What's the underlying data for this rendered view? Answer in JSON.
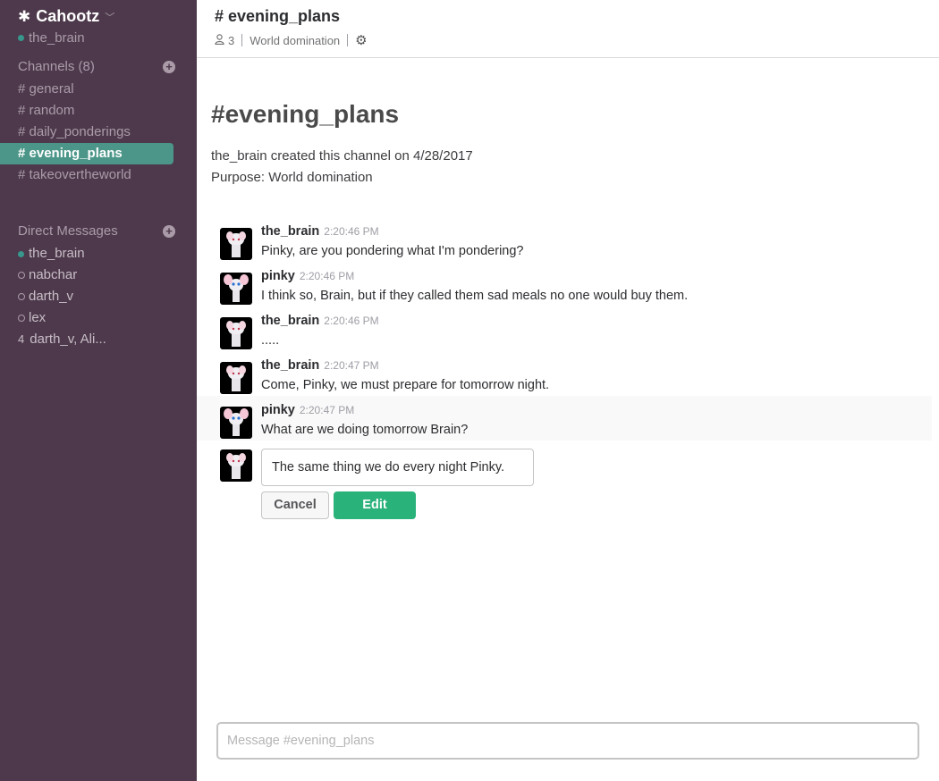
{
  "team": {
    "name": "Cahootz",
    "user": "the_brain"
  },
  "channels": {
    "heading": "Channels (8)",
    "items": [
      {
        "label": "# general"
      },
      {
        "label": "# random"
      },
      {
        "label": "# daily_ponderings"
      },
      {
        "label": "# evening_plans",
        "active": true
      },
      {
        "label": "# takeovertheworld"
      }
    ]
  },
  "dms": {
    "heading": "Direct Messages",
    "items": [
      {
        "label": "the_brain",
        "status": "online"
      },
      {
        "label": "nabchar",
        "status": "offline"
      },
      {
        "label": "darth_v",
        "status": "offline"
      },
      {
        "label": "lex",
        "status": "offline"
      },
      {
        "count": "4",
        "label": "darth_v, Ali..."
      }
    ]
  },
  "header": {
    "title": "# evening_plans",
    "members": "3",
    "purpose": "World domination"
  },
  "intro": {
    "title": "#evening_plans",
    "created": "the_brain created this channel on 4/28/2017",
    "purpose": "Purpose: World domination"
  },
  "messages": [
    {
      "user": "the_brain",
      "time": "2:20:46 PM",
      "text": "Pinky, are you pondering what I'm pondering?"
    },
    {
      "user": "pinky",
      "time": "2:20:46 PM",
      "text": "I think so, Brain, but if they called them sad meals no one would buy them."
    },
    {
      "user": "the_brain",
      "time": "2:20:46 PM",
      "text": "....."
    },
    {
      "user": "the_brain",
      "time": "2:20:47 PM",
      "text": "Come, Pinky, we must prepare for tomorrow night."
    },
    {
      "user": "pinky",
      "time": "2:20:47 PM",
      "text": "What are we doing tomorrow Brain?"
    }
  ],
  "edit": {
    "value": "The same thing we do every night Pinky.",
    "cancel": "Cancel",
    "submit": "Edit"
  },
  "composer": {
    "placeholder": "Message  #evening_plans"
  },
  "colors": {
    "sidebar": "#4d394b",
    "active": "#4c9689",
    "edit_button": "#2ab27b"
  }
}
